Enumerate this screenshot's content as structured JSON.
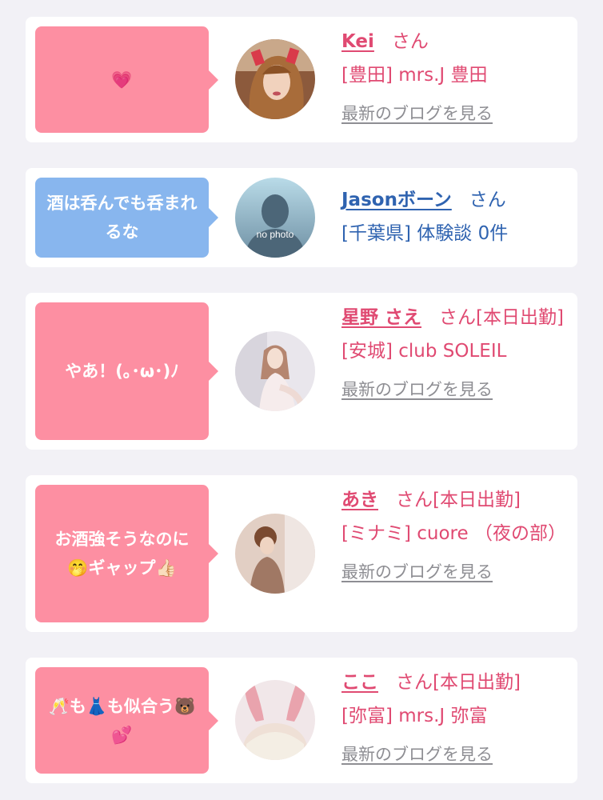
{
  "blog_link_label": "最新のブログを見る",
  "entries": [
    {
      "bubble_text": "💗",
      "name": "Kei",
      "san": "さん",
      "shop": "[豊田] mrs.J 豊田"
    },
    {
      "bubble_text": "酒は呑んでも呑まれるな",
      "name": "Jasonボーン",
      "san": "さん",
      "shop": "[千葉県] 体験談 0件",
      "avatar_text": "no photo"
    },
    {
      "bubble_text": "やあ！(｡･ω･)ﾉ",
      "name": "星野 さえ",
      "san": "さん[本日出勤]",
      "shop": "[安城] club SOLEIL"
    },
    {
      "bubble_text": "お酒強そうなのに🤭ギャップ👍🏻",
      "name": "あき",
      "san": "さん[本日出勤]",
      "shop": "[ミナミ] cuore （夜の部）"
    },
    {
      "bubble_text": "🥂も👗も似合う🐻💕",
      "name": "ここ",
      "san": "さん[本日出勤]",
      "shop": "[弥富] mrs.J 弥富"
    }
  ],
  "colors": {
    "pink_bubble": "#fd8fa2",
    "blue_bubble": "#88b6ee",
    "pink_text": "#e04a72",
    "blue_text": "#2f63b0"
  }
}
